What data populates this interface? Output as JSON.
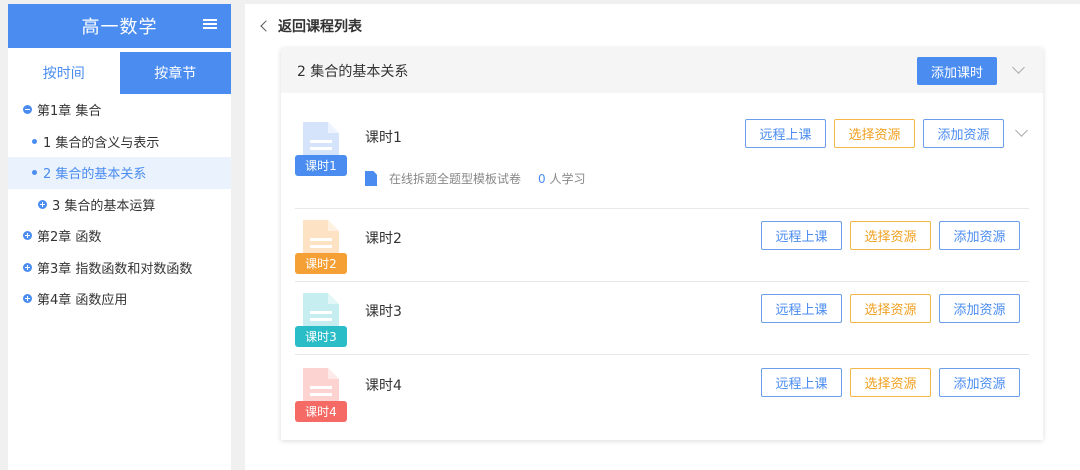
{
  "sidebar": {
    "title": "高一数学",
    "tabs": [
      {
        "label": "按时间",
        "active": false
      },
      {
        "label": "按章节",
        "active": true
      }
    ],
    "tree": [
      {
        "label": "第1章 集合",
        "level": 0,
        "expanded": true
      },
      {
        "label": "1 集合的含义与表示",
        "level": 1
      },
      {
        "label": "2 集合的基本关系",
        "level": 1,
        "selected": true
      },
      {
        "label": "3 集合的基本运算",
        "level": 1,
        "expandable": true
      },
      {
        "label": "第2章 函数",
        "level": 0,
        "expanded": false
      },
      {
        "label": "第3章 指数函数和对数函数",
        "level": 0,
        "expanded": false
      },
      {
        "label": "第4章 函数应用",
        "level": 0,
        "expanded": false
      }
    ]
  },
  "main": {
    "back_label": "返回课程列表",
    "section": {
      "title": "2 集合的基本关系",
      "add_lesson_label": "添加课时"
    },
    "lessons": [
      {
        "name": "课时1",
        "badge": "课时1",
        "color": "#4a8cf0",
        "light": "#d6e4fb",
        "resource": {
          "title": "在线拆题全题型模板试卷",
          "count": "0",
          "suffix": "人学习"
        }
      },
      {
        "name": "课时2",
        "badge": "课时2",
        "color": "#f5a035",
        "light": "#fde3c4"
      },
      {
        "name": "课时3",
        "badge": "课时3",
        "color": "#2bbdc7",
        "light": "#c6edf0"
      },
      {
        "name": "课时4",
        "badge": "课时4",
        "color": "#f56a64",
        "light": "#fdd3d1"
      }
    ],
    "buttons": {
      "remote": "远程上课",
      "select": "选择资源",
      "add": "添加资源"
    }
  }
}
